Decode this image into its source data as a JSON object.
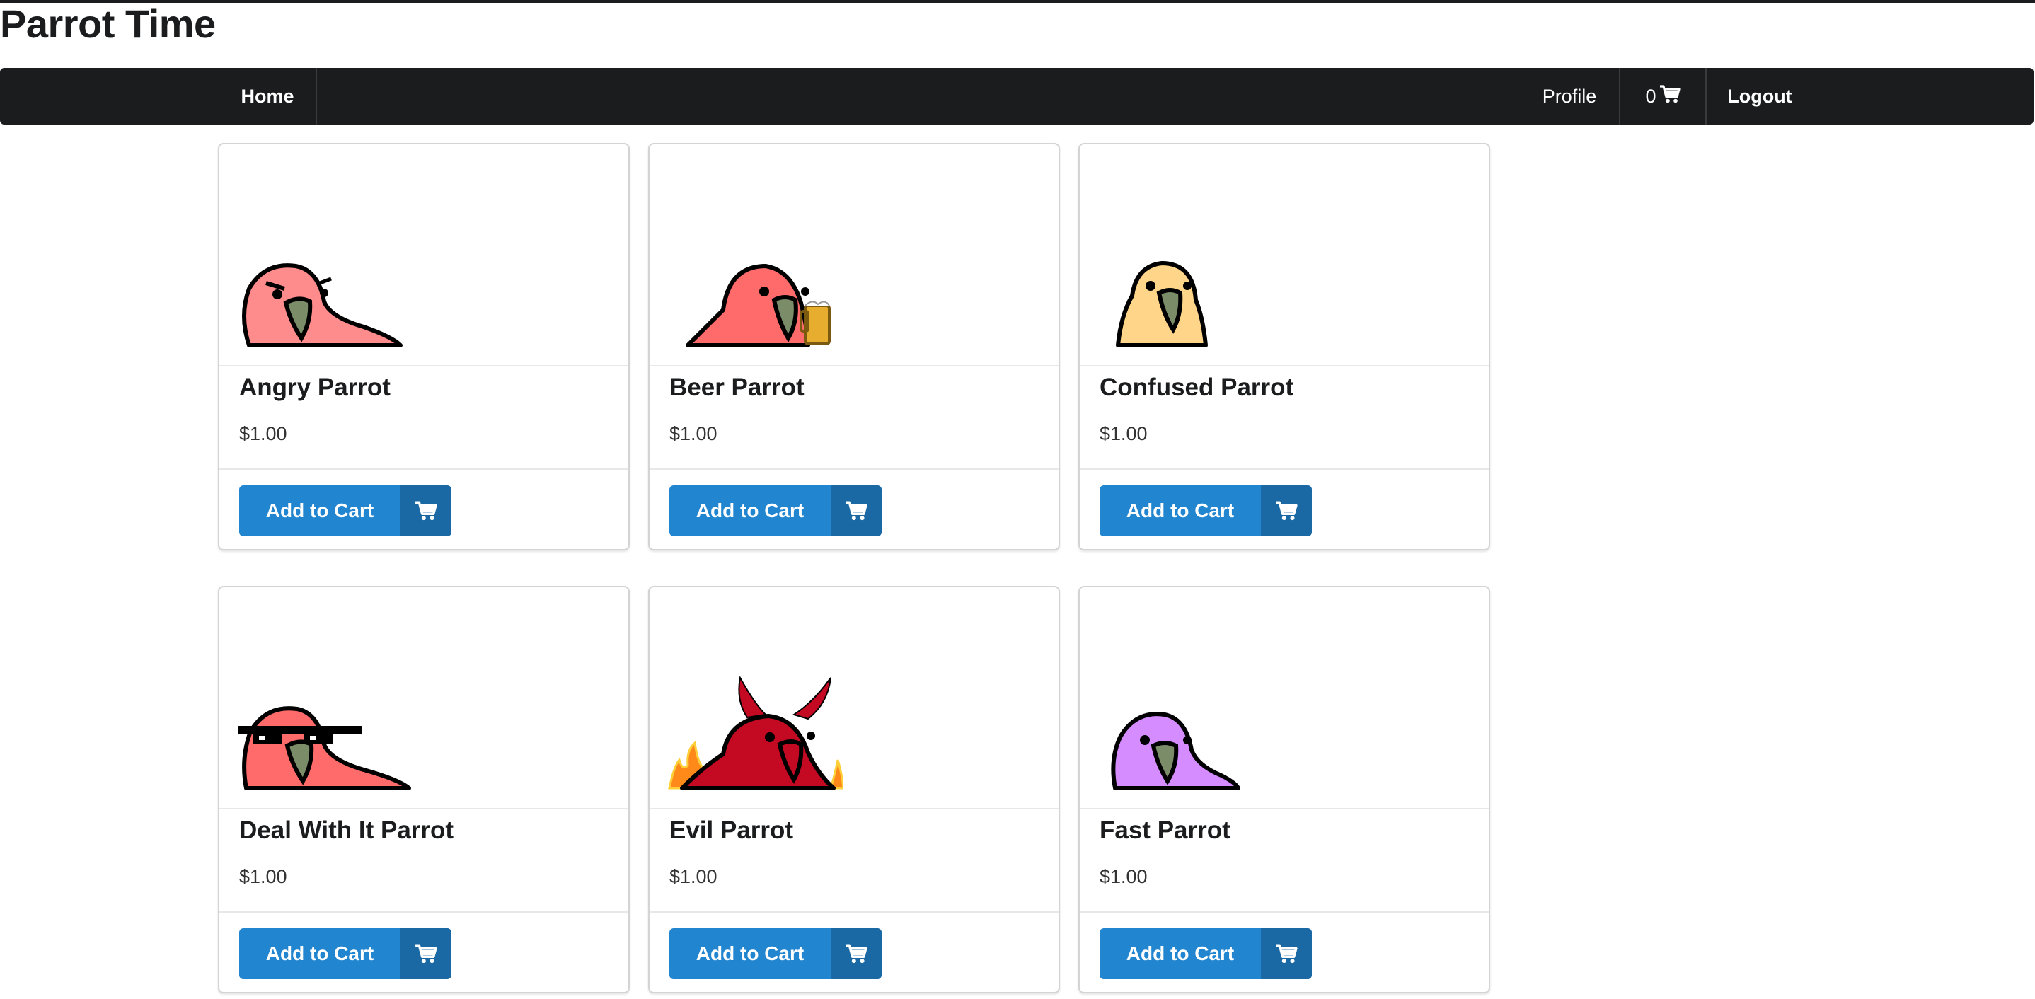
{
  "header": {
    "title": "Parrot Time"
  },
  "nav": {
    "home_label": "Home",
    "profile_label": "Profile",
    "cart_count": "0",
    "logout_label": "Logout",
    "cart_icon": "cart-icon"
  },
  "products": [
    {
      "name": "Angry Parrot",
      "price": "$1.00",
      "button_label": "Add to Cart",
      "image": "angry-parrot"
    },
    {
      "name": "Beer Parrot",
      "price": "$1.00",
      "button_label": "Add to Cart",
      "image": "beer-parrot"
    },
    {
      "name": "Confused Parrot",
      "price": "$1.00",
      "button_label": "Add to Cart",
      "image": "confused-parrot"
    },
    {
      "name": "Deal With It Parrot",
      "price": "$1.00",
      "button_label": "Add to Cart",
      "image": "deal-with-it-parrot"
    },
    {
      "name": "Evil Parrot",
      "price": "$1.00",
      "button_label": "Add to Cart",
      "image": "evil-parrot"
    },
    {
      "name": "Fast Parrot",
      "price": "$1.00",
      "button_label": "Add to Cart",
      "image": "fast-parrot"
    }
  ],
  "colors": {
    "navbar": "#1b1c1d",
    "button": "#2185d0",
    "button_icon_bg": "#1a69a4",
    "angry_parrot": "#ff8c8c",
    "beer_parrot": "#ff6b6b",
    "confused_parrot": "#ffd58a",
    "deal_with_it_parrot": "#ff6b6b",
    "evil_parrot": "#c40a22",
    "fast_parrot": "#d58cff",
    "beak": "#7a8c68"
  }
}
